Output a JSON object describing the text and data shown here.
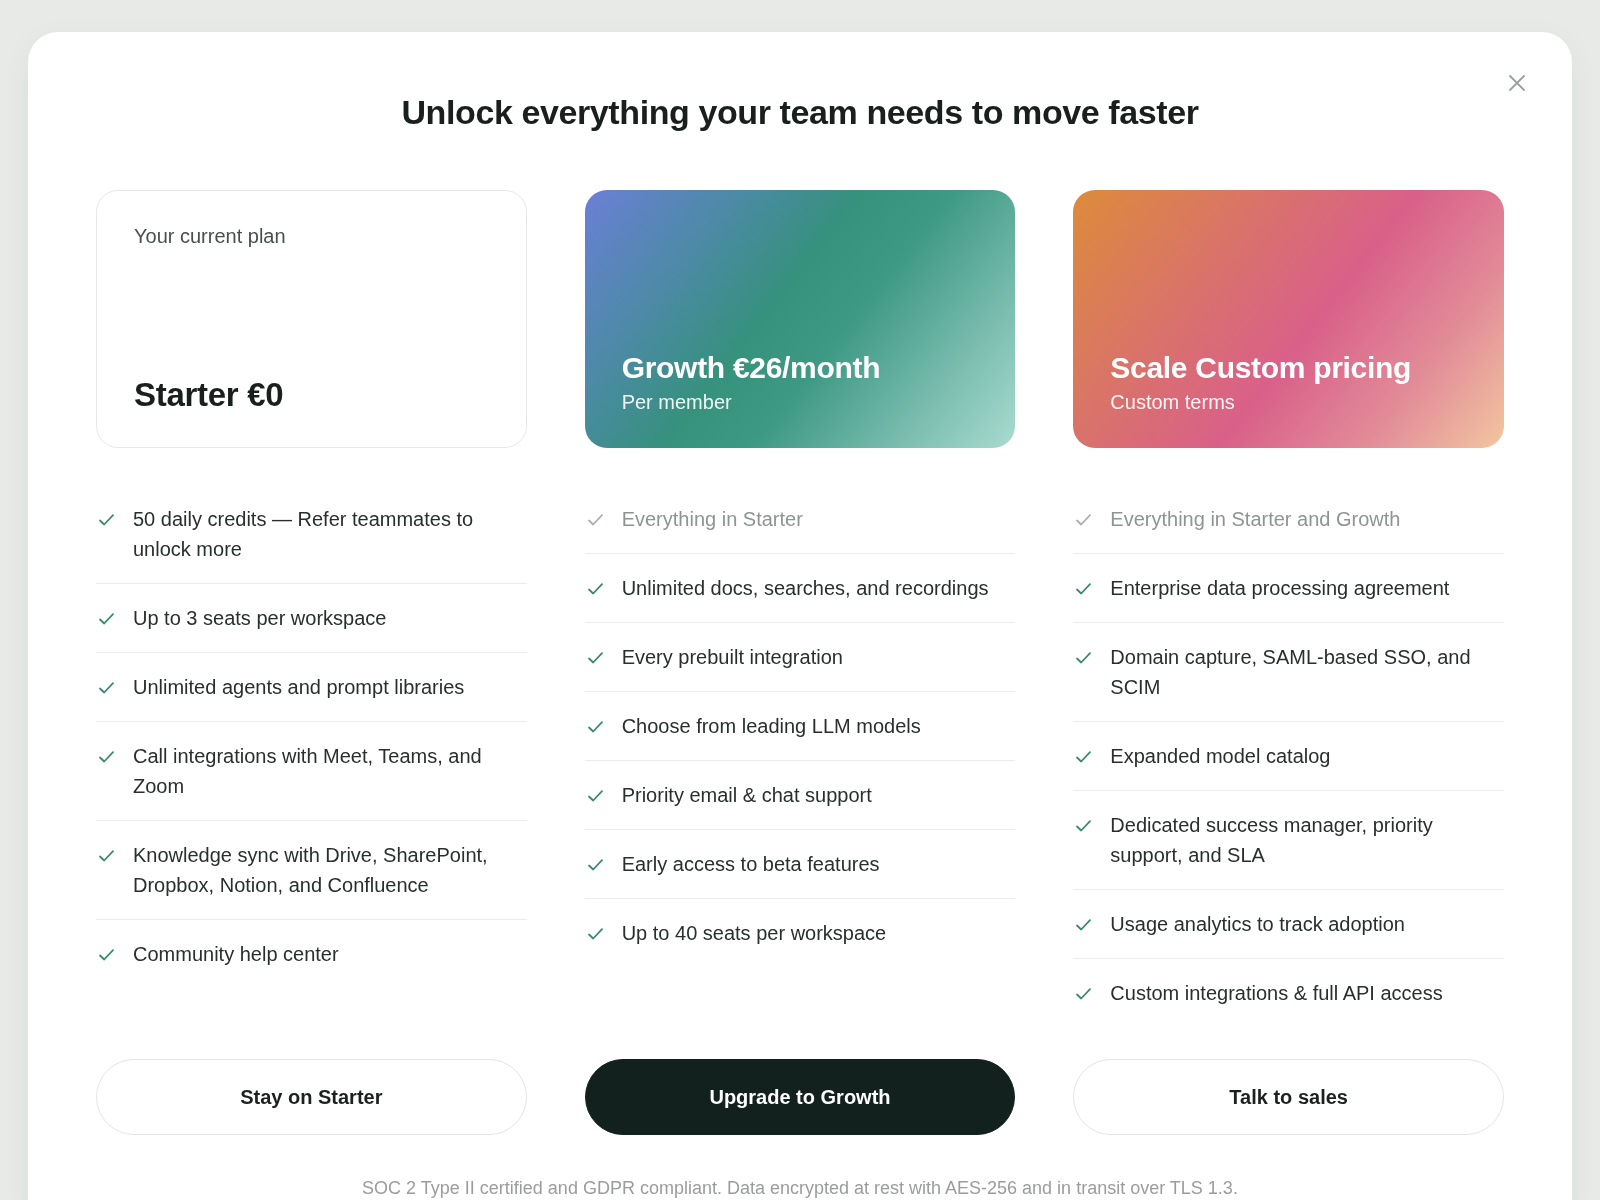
{
  "dialog": {
    "title": "Unlock everything your team needs to move faster"
  },
  "plans": [
    {
      "kind": "outline",
      "caption": "Your current plan",
      "title": "Starter €0",
      "features": [
        {
          "text": "50 daily credits — Refer teammates to unlock more",
          "muted": false
        },
        {
          "text": "Up to 3 seats per workspace",
          "muted": false
        },
        {
          "text": "Unlimited agents and prompt libraries",
          "muted": false
        },
        {
          "text": "Call integrations with Meet, Teams, and Zoom",
          "muted": false
        },
        {
          "text": "Knowledge sync with Drive, SharePoint, Dropbox, Notion, and Confluence",
          "muted": false
        },
        {
          "text": "Community help center",
          "muted": false
        }
      ],
      "button": {
        "label": "Stay on Starter",
        "kind": "outline"
      }
    },
    {
      "kind": "teal",
      "title": "Growth €26/month",
      "subtitle": "Per member",
      "features": [
        {
          "text": "Everything in Starter",
          "muted": true
        },
        {
          "text": "Unlimited docs, searches, and recordings",
          "muted": false
        },
        {
          "text": "Every prebuilt integration",
          "muted": false
        },
        {
          "text": "Choose from leading LLM models",
          "muted": false
        },
        {
          "text": "Priority email & chat support",
          "muted": false
        },
        {
          "text": "Early access to beta features",
          "muted": false
        },
        {
          "text": "Up to 40 seats per workspace",
          "muted": false
        }
      ],
      "button": {
        "label": "Upgrade to Growth",
        "kind": "primary"
      }
    },
    {
      "kind": "sunset",
      "title": "Scale Custom pricing",
      "subtitle": "Custom terms",
      "features": [
        {
          "text": "Everything in Starter and Growth",
          "muted": true
        },
        {
          "text": "Enterprise data processing agreement",
          "muted": false
        },
        {
          "text": "Domain capture, SAML-based SSO, and SCIM",
          "muted": false
        },
        {
          "text": "Expanded model catalog",
          "muted": false
        },
        {
          "text": "Dedicated success manager, priority support, and SLA",
          "muted": false
        },
        {
          "text": "Usage analytics to track adoption",
          "muted": false
        },
        {
          "text": "Custom integrations & full API access",
          "muted": false
        }
      ],
      "button": {
        "label": "Talk to sales",
        "kind": "outline"
      }
    }
  ],
  "footer": {
    "note": "SOC 2 Type II certified and GDPR compliant. Data encrypted at rest with AES-256 and in transit over TLS 1.3."
  }
}
